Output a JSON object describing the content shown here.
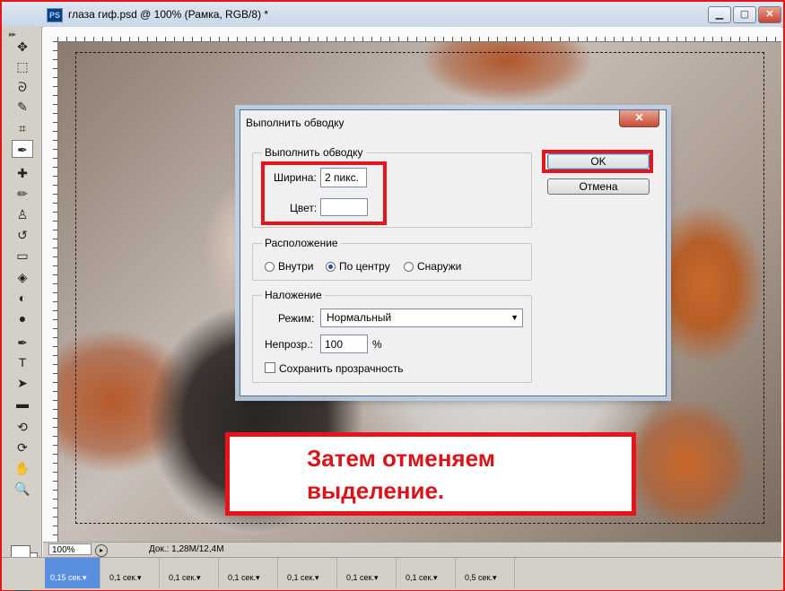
{
  "window": {
    "app_icon": "PS",
    "title": "глаза гиф.psd @ 100% (Рамка, RGB/8) *",
    "controls": [
      "minimize-icon",
      "maximize-icon",
      "close-icon"
    ]
  },
  "toolbox": {
    "grip": "▸▸",
    "tools": [
      {
        "name": "move",
        "glyph": "✥"
      },
      {
        "name": "marquee",
        "glyph": "⬚"
      },
      {
        "name": "lasso",
        "glyph": "ᘐ"
      },
      {
        "name": "quick-selection",
        "glyph": "✎"
      },
      {
        "name": "crop",
        "glyph": "⌗"
      },
      {
        "name": "eyedropper",
        "glyph": "✒"
      },
      {
        "name": "healing-brush",
        "glyph": "✚"
      },
      {
        "name": "brush",
        "glyph": "✏"
      },
      {
        "name": "clone-stamp",
        "glyph": "♙"
      },
      {
        "name": "history-brush",
        "glyph": "↺"
      },
      {
        "name": "eraser",
        "glyph": "▭"
      },
      {
        "name": "paint-bucket",
        "glyph": "◈"
      },
      {
        "name": "blur",
        "glyph": "◐"
      },
      {
        "name": "dodge",
        "glyph": "●"
      },
      {
        "name": "pen",
        "glyph": "✒"
      },
      {
        "name": "type",
        "glyph": "T"
      },
      {
        "name": "path-selection",
        "glyph": "➤"
      },
      {
        "name": "rectangle",
        "glyph": "▬"
      },
      {
        "name": "3d-rotate",
        "glyph": "⟲"
      },
      {
        "name": "3d-orbit",
        "glyph": "⟳"
      },
      {
        "name": "hand",
        "glyph": "✋"
      },
      {
        "name": "zoom",
        "glyph": "🔍"
      }
    ],
    "active_tool": "eyedropper"
  },
  "status": {
    "zoom": "100%",
    "doc": "Док.: 1,28M/12,4M"
  },
  "animation": {
    "frames": [
      {
        "delay": "0,15 сек.▾"
      },
      {
        "delay": "0,1 сек.▾"
      },
      {
        "delay": "0,1 сек.▾"
      },
      {
        "delay": "0,1 сек.▾"
      },
      {
        "delay": "0,1 сек.▾"
      },
      {
        "delay": "0,1 сек.▾"
      },
      {
        "delay": "0,1 сек.▾"
      },
      {
        "delay": "0,5 сек.▾"
      }
    ],
    "selected_index": 0
  },
  "dialog": {
    "title": "Выполнить обводку",
    "stroke_group": "Выполнить обводку",
    "width_label": "Ширина:",
    "width_value": "2 пикс.",
    "color_label": "Цвет:",
    "color_value": "#ffffff",
    "location_group": "Расположение",
    "location_options": [
      "Внутри",
      "По центру",
      "Снаружи"
    ],
    "location_selected": "По центру",
    "blending_group": "Наложение",
    "mode_label": "Режим:",
    "mode_value": "Нормальный",
    "opacity_label": "Непрозр.:",
    "opacity_value": "100",
    "opacity_unit": "%",
    "preserve_label": "Сохранить прозрачность",
    "preserve_checked": false,
    "ok_label": "OK",
    "cancel_label": "Отмена"
  },
  "annotation": {
    "text": "Затем отменяем\nвыделение.",
    "color": "#d8141c"
  }
}
